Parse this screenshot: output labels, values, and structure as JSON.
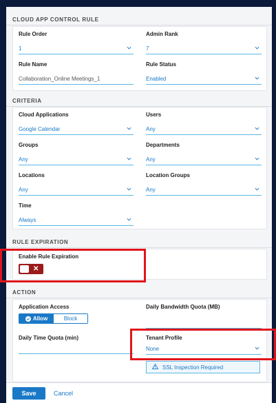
{
  "sections": {
    "cloud_app_control_rule": "CLOUD APP CONTROL RULE",
    "criteria": "CRITERIA",
    "rule_expiration": "RULE EXPIRATION",
    "action": "ACTION"
  },
  "rule": {
    "rule_order": {
      "label": "Rule Order",
      "value": "1"
    },
    "admin_rank": {
      "label": "Admin Rank",
      "value": "7"
    },
    "rule_name": {
      "label": "Rule Name",
      "value": "Collaboration_Online Meetings_1"
    },
    "rule_status": {
      "label": "Rule Status",
      "value": "Enabled"
    }
  },
  "criteria": {
    "cloud_applications": {
      "label": "Cloud Applications",
      "value": "Google Calendar"
    },
    "users": {
      "label": "Users",
      "value": "Any"
    },
    "groups": {
      "label": "Groups",
      "value": "Any"
    },
    "departments": {
      "label": "Departments",
      "value": "Any"
    },
    "locations": {
      "label": "Locations",
      "value": "Any"
    },
    "location_groups": {
      "label": "Location Groups",
      "value": "Any"
    },
    "time": {
      "label": "Time",
      "value": "Always"
    }
  },
  "expiration": {
    "label": "Enable Rule Expiration",
    "toggle_icon": "x-icon"
  },
  "action": {
    "application_access": {
      "label": "Application Access",
      "allow": "Allow",
      "block": "Block",
      "selected": "Allow"
    },
    "daily_bandwidth_quota": {
      "label": "Daily Bandwidth Quota (MB)",
      "value": ""
    },
    "daily_time_quota": {
      "label": "Daily Time Quota (min)",
      "value": ""
    },
    "tenant_profile": {
      "label": "Tenant Profile",
      "value": "None"
    },
    "ssl_notice": "SSL Inspection Required"
  },
  "footer": {
    "save_label": "Save",
    "cancel_label": "Cancel"
  },
  "colors": {
    "accent": "#1a79c7",
    "highlight": "#e1141b",
    "toggle_off": "#9b1b1b"
  }
}
